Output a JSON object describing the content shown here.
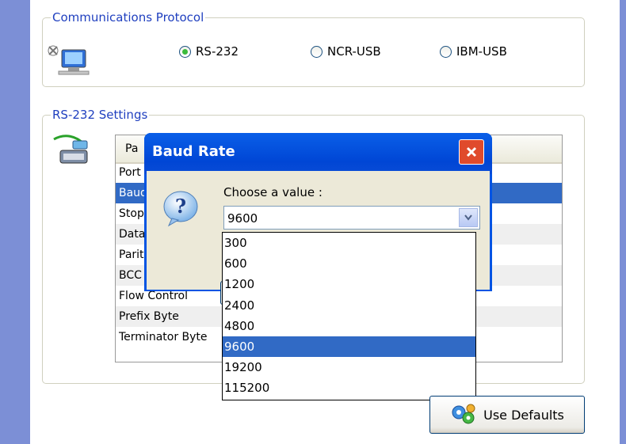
{
  "protocol_group": {
    "title": "Communications Protocol",
    "options": [
      {
        "label": "RS-232",
        "selected": true
      },
      {
        "label": "NCR-USB",
        "selected": false
      },
      {
        "label": "IBM-USB",
        "selected": false
      }
    ]
  },
  "settings_group": {
    "title": "RS-232 Settings",
    "table_header": "Pa",
    "rows": [
      "Port",
      "Baud",
      "Stop",
      "Data",
      "Parit",
      "BCC",
      "Flow Control",
      "Prefix Byte",
      "Terminator Byte"
    ],
    "selected_row": 1
  },
  "dialog": {
    "title": "Baud Rate",
    "prompt": "Choose a value :",
    "current_value": "9600",
    "options": [
      "300",
      "600",
      "1200",
      "2400",
      "4800",
      "9600",
      "19200",
      "115200"
    ],
    "selected_option": "9600"
  },
  "defaults_button": {
    "label": "Use Defaults"
  }
}
